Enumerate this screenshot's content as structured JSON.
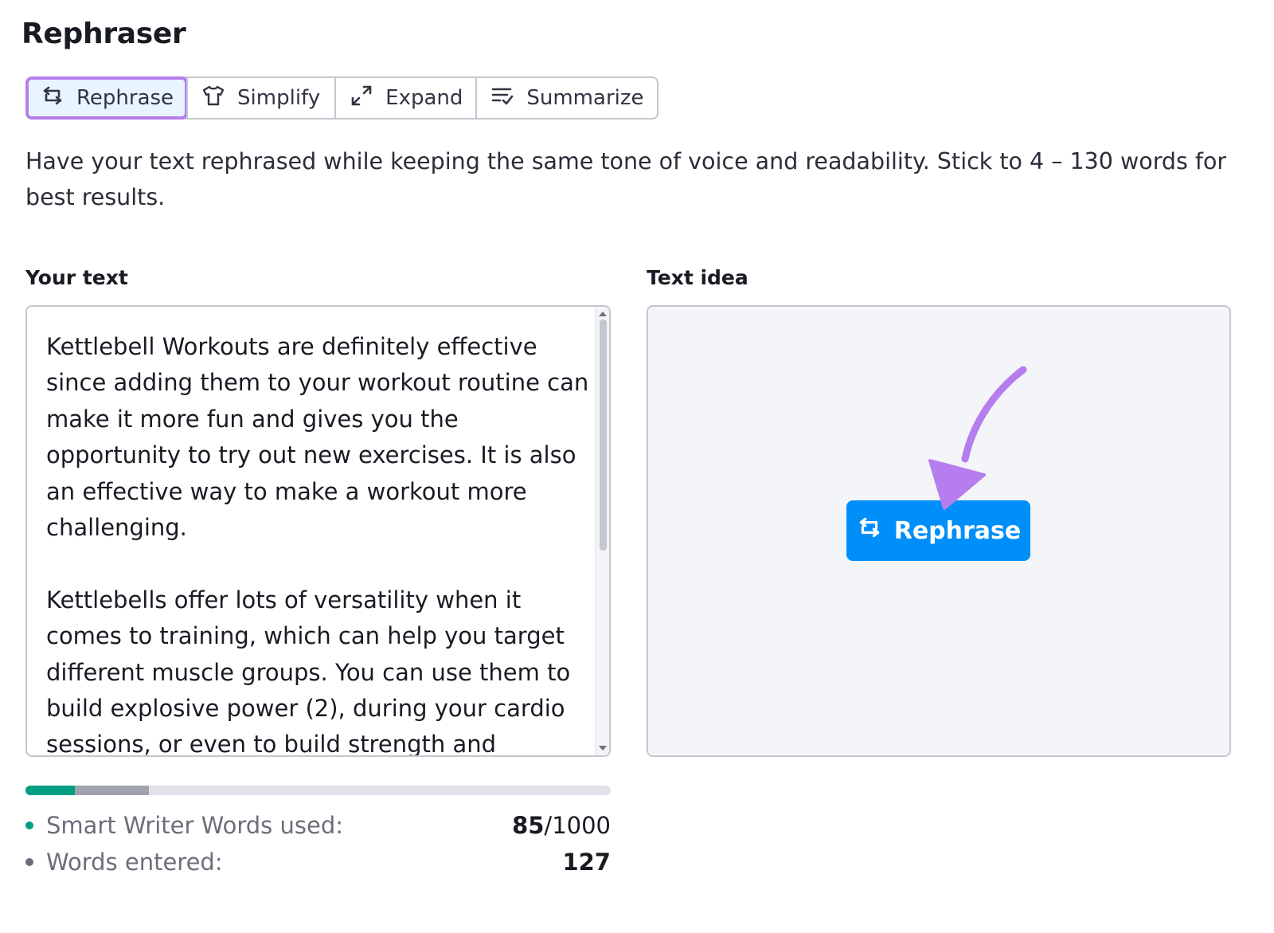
{
  "page": {
    "title": "Rephraser"
  },
  "modes": {
    "active": "Rephrase",
    "items": [
      {
        "label": "Rephrase",
        "icon": "rephrase-icon"
      },
      {
        "label": "Simplify",
        "icon": "shirt-icon"
      },
      {
        "label": "Expand",
        "icon": "expand-icon"
      },
      {
        "label": "Summarize",
        "icon": "summarize-icon"
      }
    ]
  },
  "description": "Have your text rephrased while keeping the same tone of voice and readability. Stick to 4 – 130 words for best results.",
  "input": {
    "label": "Your text",
    "text": "Kettlebell Workouts are definitely effective since adding them to your workout routine can make it more fun and gives you the opportunity to try out new exercises. It is also an effective way to make a workout more challenging.\n\nKettlebells offer lots of versatility when it comes to training, which can help you target different muscle groups. You can use them to build explosive power (2), during your cardio sessions, or even to build strength and"
  },
  "output": {
    "label": "Text idea",
    "button_label": "Rephrase"
  },
  "usage": {
    "words_used_label": "Smart Writer Words used:",
    "words_used": "85",
    "words_limit": "/1000",
    "words_entered_label": "Words entered:",
    "words_entered": "127",
    "used_fraction": 0.085,
    "entered_fraction": 0.127
  },
  "colors": {
    "accent_blue": "#008ff8",
    "highlight_purple": "#b57dee",
    "used_green": "#009f81",
    "entered_gray": "#a0a2ad"
  }
}
